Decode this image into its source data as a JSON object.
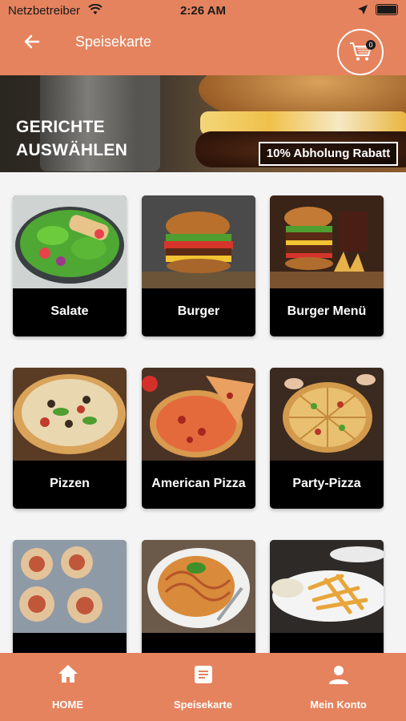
{
  "status": {
    "carrier": "Netzbetreiber",
    "time": "2:26 AM"
  },
  "appbar": {
    "title": "Speisekarte",
    "cart_count": "0"
  },
  "banner": {
    "line1": "GERICHTE",
    "line2": "AUSWÄHLEN",
    "badge": "10% Abholung Rabatt"
  },
  "categories": [
    {
      "label": "Salate"
    },
    {
      "label": "Burger"
    },
    {
      "label": "Burger Menü"
    },
    {
      "label": "Pizzen"
    },
    {
      "label": "American Pizza"
    },
    {
      "label": "Party-Pizza"
    },
    {
      "label": ""
    },
    {
      "label": ""
    },
    {
      "label": ""
    }
  ],
  "bottom_nav": [
    {
      "label": "HOME",
      "icon": "home-icon"
    },
    {
      "label": "Speisekarte",
      "icon": "menu-document-icon"
    },
    {
      "label": "Mein Konto",
      "icon": "user-icon"
    }
  ],
  "colors": {
    "accent": "#e5835e",
    "card": "#000000",
    "background": "#f4f4f4"
  }
}
